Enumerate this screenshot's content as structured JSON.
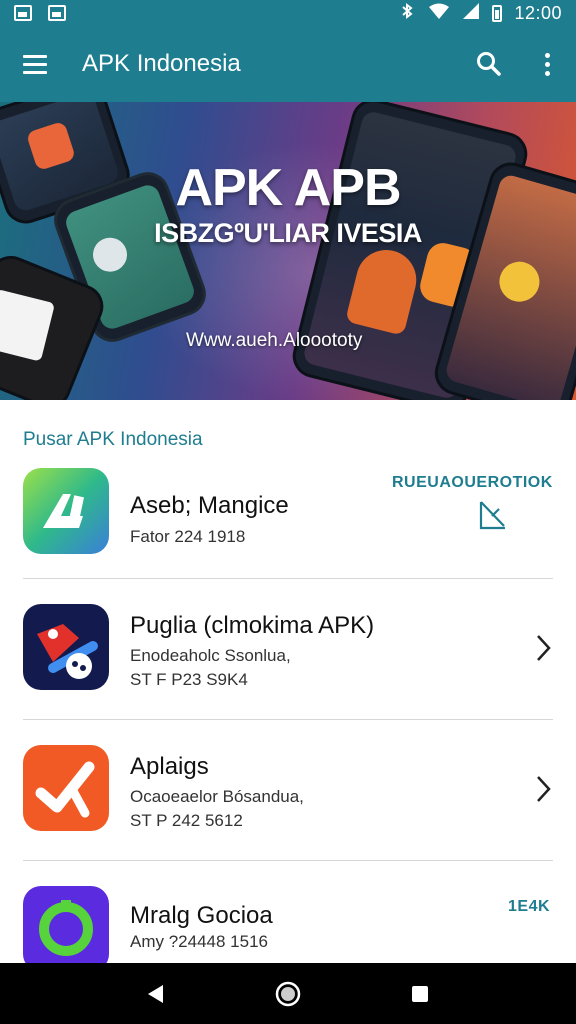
{
  "status_bar": {
    "time": "12:00",
    "left_icons": [
      "image-icon",
      "gallery-icon"
    ],
    "right_icons": [
      "bluetooth-icon",
      "wifi-icon",
      "signal-icon",
      "battery-icon"
    ]
  },
  "app_bar": {
    "title": "APK Indonesia",
    "background": "#1f7d90"
  },
  "banner": {
    "title": "APK APB",
    "subtitle": "ISBZGºU'LIAR IVESIA",
    "url": "Www.aueh.Alooototy"
  },
  "section": {
    "title": "Pusar APK Indonesia"
  },
  "apps": [
    {
      "name": "Aseb; Mangice",
      "description": "",
      "meta": "Fator 224 1918",
      "side_label": "RUEUAOUEROTIOK",
      "action": "share-icon"
    },
    {
      "name": "Puglia (clmokima APK)",
      "description": "Enodeaholc Ssonlua,",
      "meta": "ST F P23 S9K4",
      "side_label": "",
      "action": "chevron-right-icon"
    },
    {
      "name": "Aplaigs",
      "description": "Ocaoeaelor Bósandua,",
      "meta": "ST P 242 5612",
      "side_label": "",
      "action": "chevron-right-icon"
    },
    {
      "name": "Mralg Gocioa",
      "description": "",
      "meta": "Amy ?24448 1516",
      "side_label": "1E4K",
      "action": ""
    }
  ],
  "colors": {
    "accent": "#1f7d90",
    "nav": "#000000"
  }
}
